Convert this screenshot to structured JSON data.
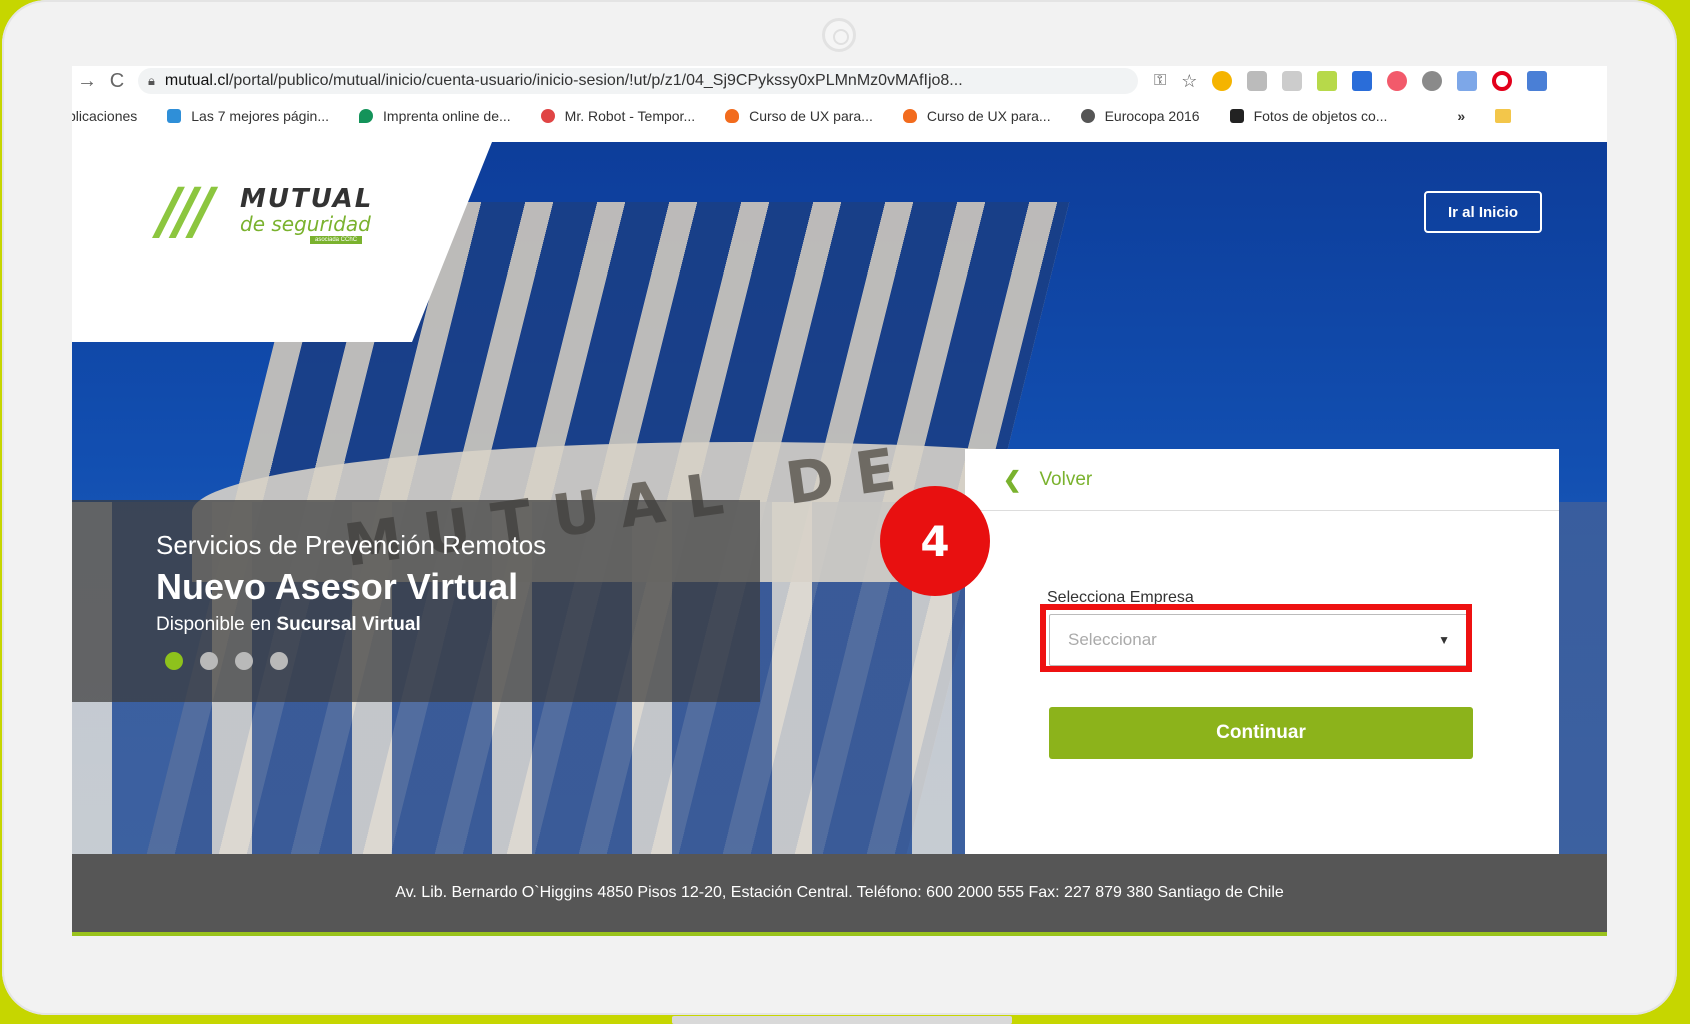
{
  "browser": {
    "url_host": "mutual.cl",
    "url_path": "/portal/publico/mutual/inicio/cuenta-usuario/inicio-sesion/!ut/p/z1/04_Sj9CPykssy0xPLMnMz0vMAfIjo8...",
    "bookmarks": [
      "plicaciones",
      "Las 7 mejores págin...",
      "Imprenta online de...",
      "Mr. Robot - Tempor...",
      "Curso de UX para...",
      "Curso de UX para...",
      "Eurocopa 2016",
      "Fotos de objetos co..."
    ],
    "bookmarks_more": "»"
  },
  "header": {
    "logo_main": "MUTUAL",
    "logo_sub": "de seguridad",
    "logo_tag": "asociada CChC",
    "home_button": "Ir al Inicio"
  },
  "hero": {
    "building_text": "MUTUAL DE",
    "subtitle": "Servicios de Prevención Remotos",
    "title": "Nuevo Asesor Virtual",
    "note_prefix": "Disponible en",
    "note_strong": "Sucursal Virtual",
    "slides_total": 4,
    "slide_active": 1
  },
  "login_card": {
    "back_label": "Volver",
    "field_label": "Selecciona Empresa",
    "select_placeholder": "Seleccionar",
    "continue_label": "Continuar"
  },
  "annotation": {
    "step_number": "4",
    "highlight_color": "#ee1111"
  },
  "footer": {
    "address": "Av. Lib. Bernardo O`Higgins 4850 Pisos 12-20, Estación Central. Teléfono: 600 2000 555 Fax: 227 879 380 Santiago de Chile"
  },
  "colors": {
    "brand_green": "#8cb31b",
    "frame_lime": "#c6d600",
    "hero_blue": "#124fb1"
  }
}
